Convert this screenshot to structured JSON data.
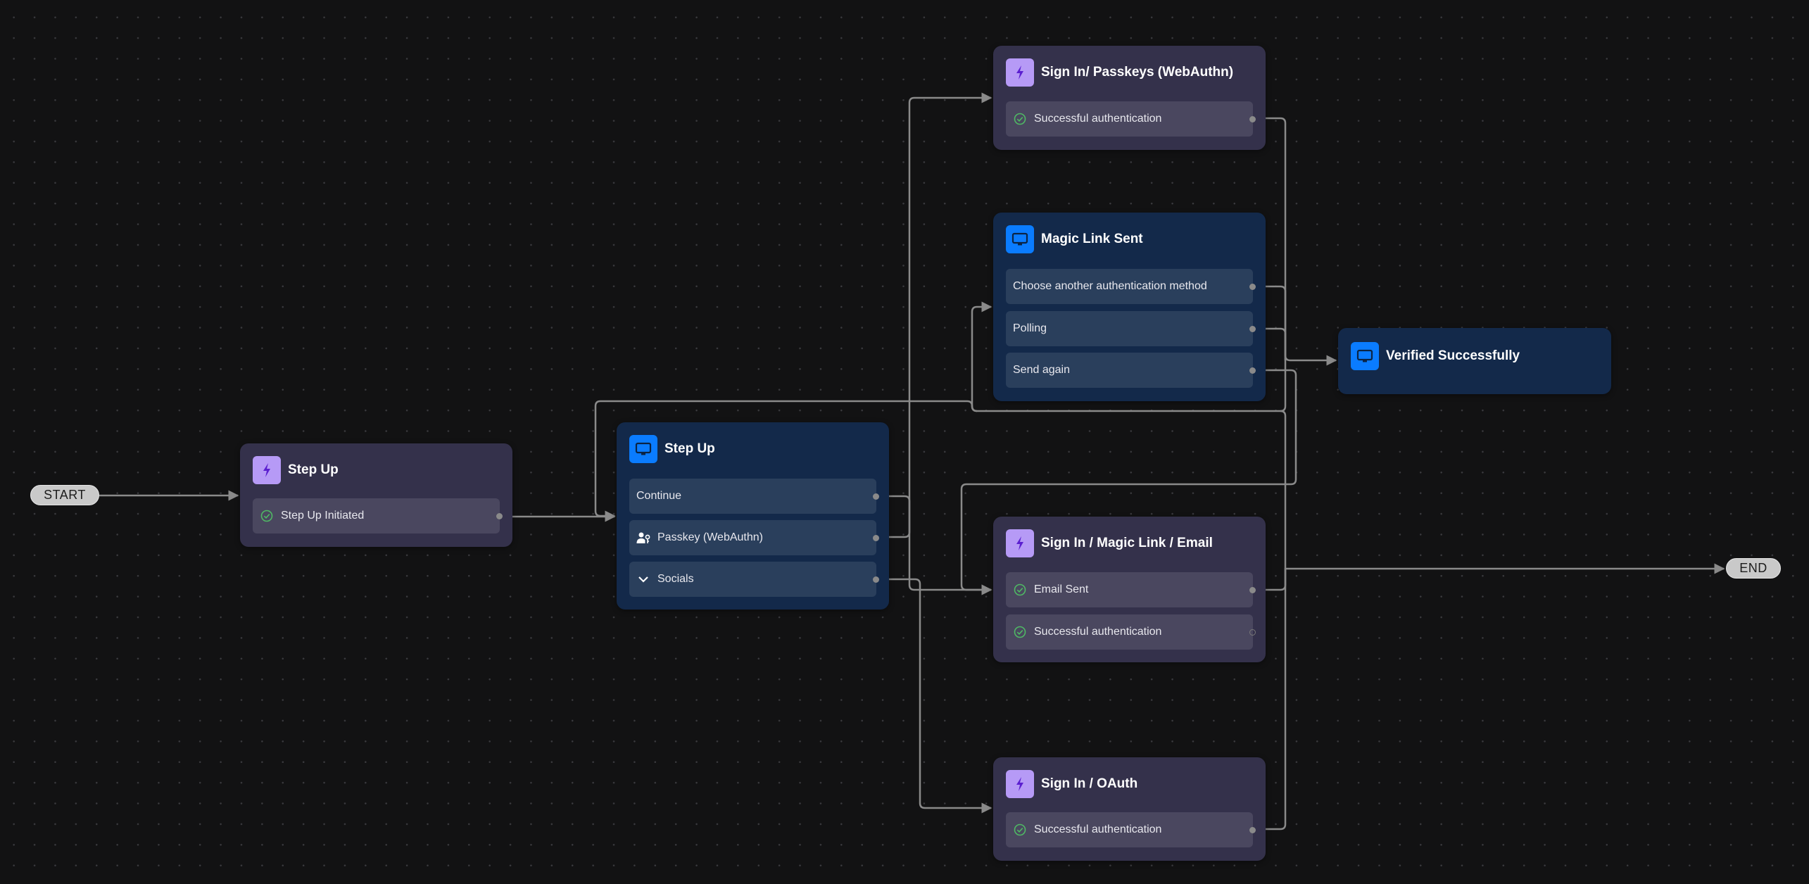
{
  "canvas": {
    "type": "flow-editor",
    "background": "dotted-grid"
  },
  "colors": {
    "action_node_bg": "#34314b",
    "screen_node_bg": "#13294a",
    "action_badge": "#b69af6",
    "screen_badge": "#0a7cff",
    "edge": "#8a8a8a",
    "success_check": "#4fb864"
  },
  "terminals": {
    "start": {
      "label": "START"
    },
    "end": {
      "label": "END"
    }
  },
  "nodes": {
    "step_up_action": {
      "kind": "action",
      "icon": "lightning-icon",
      "title": "Step Up",
      "outputs": [
        {
          "label": "Step Up Initiated",
          "icon": "check-circle-icon"
        }
      ]
    },
    "step_up_screen": {
      "kind": "screen",
      "icon": "monitor-icon",
      "title": "Step Up",
      "outputs": [
        {
          "label": "Continue",
          "icon": ""
        },
        {
          "label": "Passkey (WebAuthn)",
          "icon": "user-key-icon"
        },
        {
          "label": "Socials",
          "icon": "chevron-down-icon"
        }
      ]
    },
    "passkeys": {
      "kind": "action",
      "icon": "lightning-icon",
      "title": "Sign In/ Passkeys (WebAuthn)",
      "outputs": [
        {
          "label": "Successful authentication",
          "icon": "check-circle-icon"
        }
      ]
    },
    "magic_link_sent": {
      "kind": "screen",
      "icon": "monitor-icon",
      "title": "Magic Link Sent",
      "outputs": [
        {
          "label": "Choose another authentication method"
        },
        {
          "label": "Polling"
        },
        {
          "label": "Send again"
        }
      ]
    },
    "verified": {
      "kind": "screen",
      "icon": "monitor-icon",
      "title": "Verified Successfully",
      "outputs": []
    },
    "magic_link_email": {
      "kind": "action",
      "icon": "lightning-icon",
      "title": "Sign In / Magic Link / Email",
      "outputs": [
        {
          "label": "Email Sent",
          "icon": "check-circle-icon",
          "connected": true
        },
        {
          "label": "Successful authentication",
          "icon": "check-circle-icon",
          "connected": false
        }
      ]
    },
    "oauth": {
      "kind": "action",
      "icon": "lightning-icon",
      "title": "Sign In / OAuth",
      "outputs": [
        {
          "label": "Successful authentication",
          "icon": "check-circle-icon"
        }
      ]
    }
  },
  "edges": [
    {
      "from": "START",
      "to": "Step Up (action)"
    },
    {
      "from": "Step Up Initiated",
      "to": "Step Up (screen)"
    },
    {
      "from": "Continue",
      "to": "Sign In / Magic Link / Email"
    },
    {
      "from": "Passkey (WebAuthn)",
      "to": "Sign In/ Passkeys (WebAuthn)"
    },
    {
      "from": "Socials",
      "to": "Sign In / OAuth"
    },
    {
      "from": "Passkeys: Successful authentication",
      "to": "Verified Successfully"
    },
    {
      "from": "Choose another authentication method",
      "to": "Step Up (screen)"
    },
    {
      "from": "Polling",
      "to": "Verified Successfully"
    },
    {
      "from": "Send again",
      "to": "Sign In / Magic Link / Email"
    },
    {
      "from": "Email Sent",
      "to": "Magic Link Sent"
    },
    {
      "from": "OAuth: Successful authentication",
      "to": "END"
    }
  ]
}
